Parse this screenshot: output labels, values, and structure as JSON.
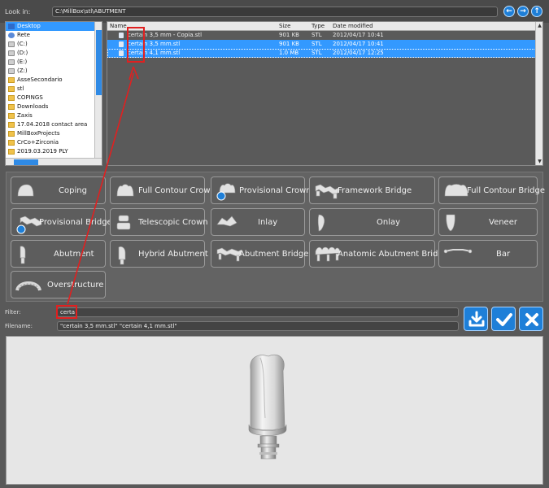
{
  "lookin": {
    "label": "Look in:",
    "path": "C:\\MillBox\\stl\\ABUTMENT"
  },
  "nav": [
    {
      "name": "back-icon",
      "glyph": "←"
    },
    {
      "name": "forward-icon",
      "glyph": "→"
    },
    {
      "name": "up-icon",
      "glyph": "↑"
    }
  ],
  "tree": [
    {
      "label": "Desktop",
      "icon": "desk",
      "selected": true
    },
    {
      "label": "Rete",
      "icon": "net"
    },
    {
      "label": "(C:)",
      "icon": "drive"
    },
    {
      "label": "(D:)",
      "icon": "drive"
    },
    {
      "label": "(E:)",
      "icon": "drive"
    },
    {
      "label": "(Z:)",
      "icon": "drive"
    },
    {
      "label": "AsseSecondario",
      "icon": "folder"
    },
    {
      "label": "stl",
      "icon": "folder"
    },
    {
      "label": "COPINGS",
      "icon": "folder"
    },
    {
      "label": "Downloads",
      "icon": "folder"
    },
    {
      "label": "Zaxis",
      "icon": "folder"
    },
    {
      "label": "17.04.2018 contact area",
      "icon": "folder"
    },
    {
      "label": "MillBoxProjects",
      "icon": "folder"
    },
    {
      "label": "CrCo+Zirconia",
      "icon": "folder"
    },
    {
      "label": "2019.03.2019 PLY",
      "icon": "folder"
    }
  ],
  "files": {
    "headers": {
      "name": "Name",
      "size": "Size",
      "type": "Type",
      "date": "Date modified"
    },
    "rows": [
      {
        "name": "certain 3,5 mm - Copia.stl",
        "size": "901 KB",
        "type": "STL",
        "date": "2012/04/17 10:41",
        "selected": false
      },
      {
        "name": "certain 3,5 mm.stl",
        "size": "901 KB",
        "type": "STL",
        "date": "2012/04/17 10:41",
        "selected": true
      },
      {
        "name": "certain 4,1 mm.stl",
        "size": "1.0 MB",
        "type": "STL",
        "date": "2012/04/17 12:25",
        "selected": true
      }
    ]
  },
  "categories": [
    "Coping",
    "Full Contour Crown",
    "Provisional Crown",
    "Framework Bridge",
    "Full Contour Bridge",
    "Provisional Bridge",
    "Telescopic Crown",
    "Inlay",
    "Onlay",
    "Veneer",
    "Abutment",
    "Hybrid Abutment",
    "Abutment Bridge",
    "Anatomic Abutment Bridge",
    "Bar",
    "Overstructure"
  ],
  "filter": {
    "label": "Filter:",
    "value": "certa"
  },
  "filename": {
    "label": "Filename:",
    "value": "\"certain 3,5 mm.stl\" \"certain 4,1 mm.stl\""
  },
  "colors": {
    "accent": "#1e7fd8",
    "selection": "#3399ff",
    "annotation": "#e02020"
  }
}
